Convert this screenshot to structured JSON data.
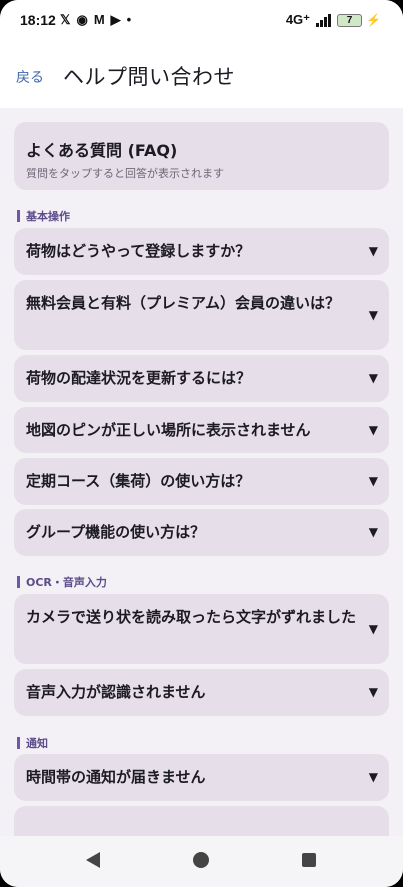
{
  "status_bar": {
    "time": "18:12",
    "network": "4G⁺",
    "battery": "7",
    "icons": [
      "x-icon",
      "threads-icon",
      "gmail-icon",
      "youtube-icon",
      "dot-icon"
    ]
  },
  "app_bar": {
    "back_label": "戻る",
    "title": "ヘルプ問い合わせ"
  },
  "faq_header": {
    "title": "よくある質問 (FAQ)",
    "subtitle": "質問をタップすると回答が表示されます"
  },
  "sections": [
    {
      "title": "基本操作",
      "questions": [
        "荷物はどうやって登録しますか？",
        "無料会員と有料（プレミアム）会員の違いは？",
        "荷物の配達状況を更新するには？",
        "地図のピンが正しい場所に表示されません",
        "定期コース（集荷）の使い方は？",
        "グループ機能の使い方は？"
      ]
    },
    {
      "title": "OCR・音声入力",
      "questions": [
        "カメラで送り状を読み取ったら文字がずれました",
        "音声入力が認識されません"
      ]
    },
    {
      "title": "通知",
      "questions": [
        "時間帯の通知が届きません"
      ]
    }
  ],
  "expand_icon": "▼",
  "colors": {
    "accent": "#6b58a8",
    "card": "#e6dee8",
    "back_link": "#3f67a8",
    "background": "#f3f1f5"
  }
}
